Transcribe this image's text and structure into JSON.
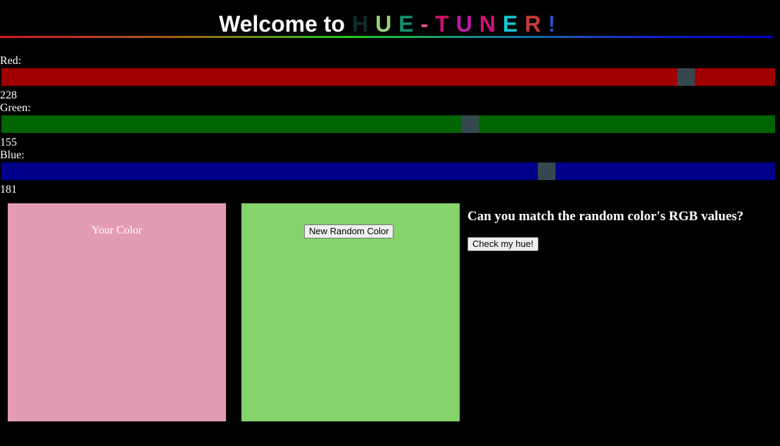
{
  "header": {
    "title_lead": "Welcome to",
    "title_letters": [
      {
        "char": "H",
        "color": "#0c2e2c"
      },
      {
        "char": "U",
        "color": "#9ed07a"
      },
      {
        "char": "E",
        "color": "#12906a"
      },
      {
        "char": "-",
        "color": "#e25a86"
      },
      {
        "char": "T",
        "color": "#d4106e"
      },
      {
        "char": "U",
        "color": "#c21aa6"
      },
      {
        "char": "N",
        "color": "#d40e78"
      },
      {
        "char": "E",
        "color": "#17c6d6"
      },
      {
        "char": "R",
        "color": "#c83a38"
      },
      {
        "char": "!",
        "color": "#2a52c8"
      }
    ]
  },
  "sliders": {
    "red": {
      "label": "Red:",
      "value": "228",
      "max": 255,
      "track_color": "#a00000"
    },
    "green": {
      "label": "Green:",
      "value": "155",
      "max": 255,
      "track_color": "#006400"
    },
    "blue": {
      "label": "Blue:",
      "value": "181",
      "max": 255,
      "track_color": "#00008b"
    }
  },
  "your_color": {
    "label": "Your Color",
    "color": "#e49bb5"
  },
  "random_color": {
    "button_label": "New Random Color",
    "color": "#85d36b"
  },
  "challenge": {
    "question": "Can you match the random color's RGB values?",
    "check_button_label": "Check my hue!"
  },
  "colors": {
    "background": "#000000",
    "thumb": "#37474f"
  }
}
